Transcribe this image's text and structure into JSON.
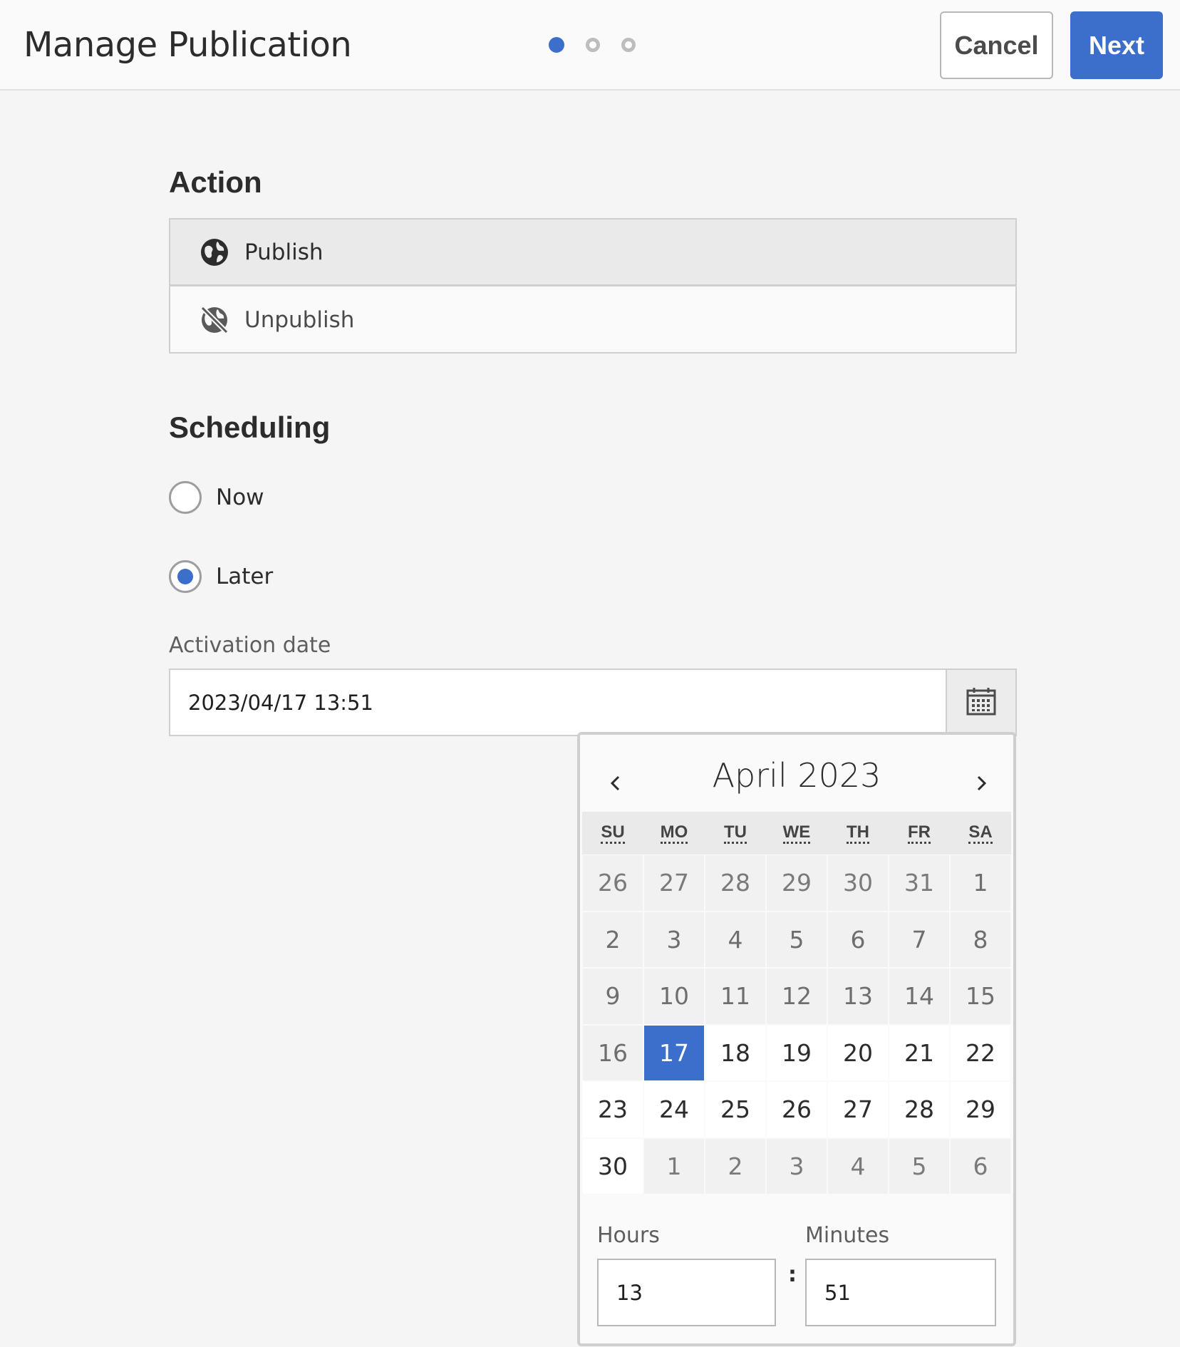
{
  "header": {
    "title": "Manage Publication",
    "cancel_label": "Cancel",
    "next_label": "Next",
    "steps": [
      {
        "state": "active"
      },
      {
        "state": "inactive"
      },
      {
        "state": "inactive"
      }
    ]
  },
  "action": {
    "heading": "Action",
    "items": [
      {
        "label": "Publish",
        "icon": "globe-icon",
        "selected": true
      },
      {
        "label": "Unpublish",
        "icon": "globe-off-icon",
        "selected": false
      }
    ]
  },
  "scheduling": {
    "heading": "Scheduling",
    "options": [
      {
        "label": "Now",
        "checked": false
      },
      {
        "label": "Later",
        "checked": true
      }
    ],
    "activation_label": "Activation date",
    "activation_value": "2023/04/17 13:51"
  },
  "calendar": {
    "month_title": "April 2023",
    "weekdays": [
      "SU",
      "MO",
      "TU",
      "WE",
      "TH",
      "FR",
      "SA"
    ],
    "weeks": [
      [
        {
          "d": "26",
          "s": "other"
        },
        {
          "d": "27",
          "s": "other"
        },
        {
          "d": "28",
          "s": "other"
        },
        {
          "d": "29",
          "s": "other"
        },
        {
          "d": "30",
          "s": "other"
        },
        {
          "d": "31",
          "s": "other"
        },
        {
          "d": "1",
          "s": "past"
        }
      ],
      [
        {
          "d": "2",
          "s": "past"
        },
        {
          "d": "3",
          "s": "past"
        },
        {
          "d": "4",
          "s": "past"
        },
        {
          "d": "5",
          "s": "past"
        },
        {
          "d": "6",
          "s": "past"
        },
        {
          "d": "7",
          "s": "past"
        },
        {
          "d": "8",
          "s": "past"
        }
      ],
      [
        {
          "d": "9",
          "s": "past"
        },
        {
          "d": "10",
          "s": "past"
        },
        {
          "d": "11",
          "s": "past"
        },
        {
          "d": "12",
          "s": "past"
        },
        {
          "d": "13",
          "s": "past"
        },
        {
          "d": "14",
          "s": "past"
        },
        {
          "d": "15",
          "s": "past"
        }
      ],
      [
        {
          "d": "16",
          "s": "past"
        },
        {
          "d": "17",
          "s": "selected"
        },
        {
          "d": "18",
          "s": "future"
        },
        {
          "d": "19",
          "s": "future"
        },
        {
          "d": "20",
          "s": "future"
        },
        {
          "d": "21",
          "s": "future"
        },
        {
          "d": "22",
          "s": "future"
        }
      ],
      [
        {
          "d": "23",
          "s": "future"
        },
        {
          "d": "24",
          "s": "future"
        },
        {
          "d": "25",
          "s": "future"
        },
        {
          "d": "26",
          "s": "future"
        },
        {
          "d": "27",
          "s": "future"
        },
        {
          "d": "28",
          "s": "future"
        },
        {
          "d": "29",
          "s": "future"
        }
      ],
      [
        {
          "d": "30",
          "s": "future"
        },
        {
          "d": "1",
          "s": "other"
        },
        {
          "d": "2",
          "s": "other"
        },
        {
          "d": "3",
          "s": "other"
        },
        {
          "d": "4",
          "s": "other"
        },
        {
          "d": "5",
          "s": "other"
        },
        {
          "d": "6",
          "s": "other"
        }
      ]
    ],
    "hours_label": "Hours",
    "minutes_label": "Minutes",
    "hours_value": "13",
    "minutes_value": "51",
    "separator": ":"
  },
  "colors": {
    "accent": "#3b6fcb",
    "background": "#f5f5f5",
    "border": "#cfcfcf"
  }
}
